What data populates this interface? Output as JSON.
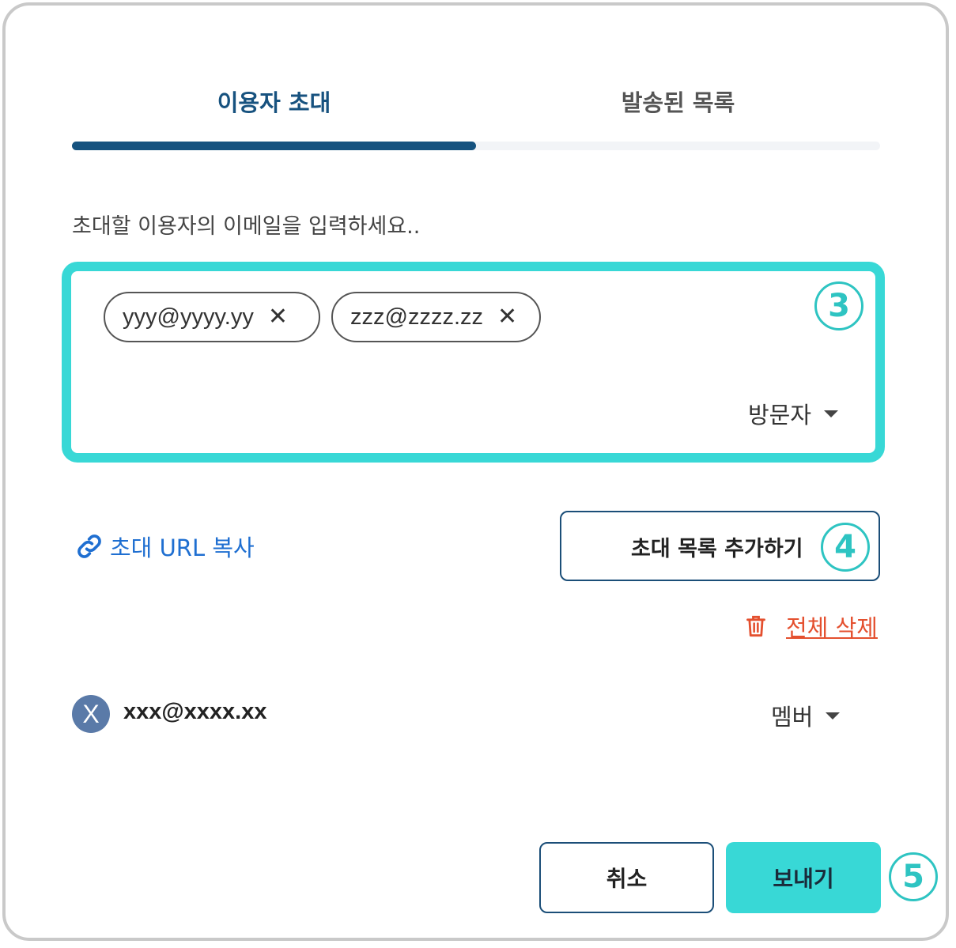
{
  "tabs": [
    {
      "label": "이용자 초대",
      "active": true
    },
    {
      "label": "발송된 목록",
      "active": false
    }
  ],
  "invite": {
    "prompt": "초대할 이용자의 이메일을 입력하세요..",
    "chips": [
      {
        "email": "yyy@yyyy.yy",
        "remove_glyph": "✕"
      },
      {
        "email": "zzz@zzzz.zz",
        "remove_glyph": "✕"
      }
    ],
    "role_label": "방문자",
    "step_badge": "3"
  },
  "actions": {
    "copy_url_label": "초대 URL 복사",
    "add_to_list_label": "초대 목록 추가하기",
    "add_step_badge": "4",
    "delete_all_label": "전체 삭제"
  },
  "members": [
    {
      "avatar": "X",
      "email": "xxx@xxxx.xx",
      "role": "멤버"
    }
  ],
  "footer": {
    "cancel_label": "취소",
    "send_label": "보내기",
    "send_step_badge": "5"
  },
  "colors": {
    "accent_teal": "#38d8d6",
    "primary_navy": "#15527f",
    "link_blue": "#1f6fd1",
    "danger_red": "#e4502f",
    "avatar_blue": "#5a7aa8"
  },
  "icons": [
    "link-icon",
    "close-icon",
    "caret-down-icon",
    "trash-icon"
  ]
}
